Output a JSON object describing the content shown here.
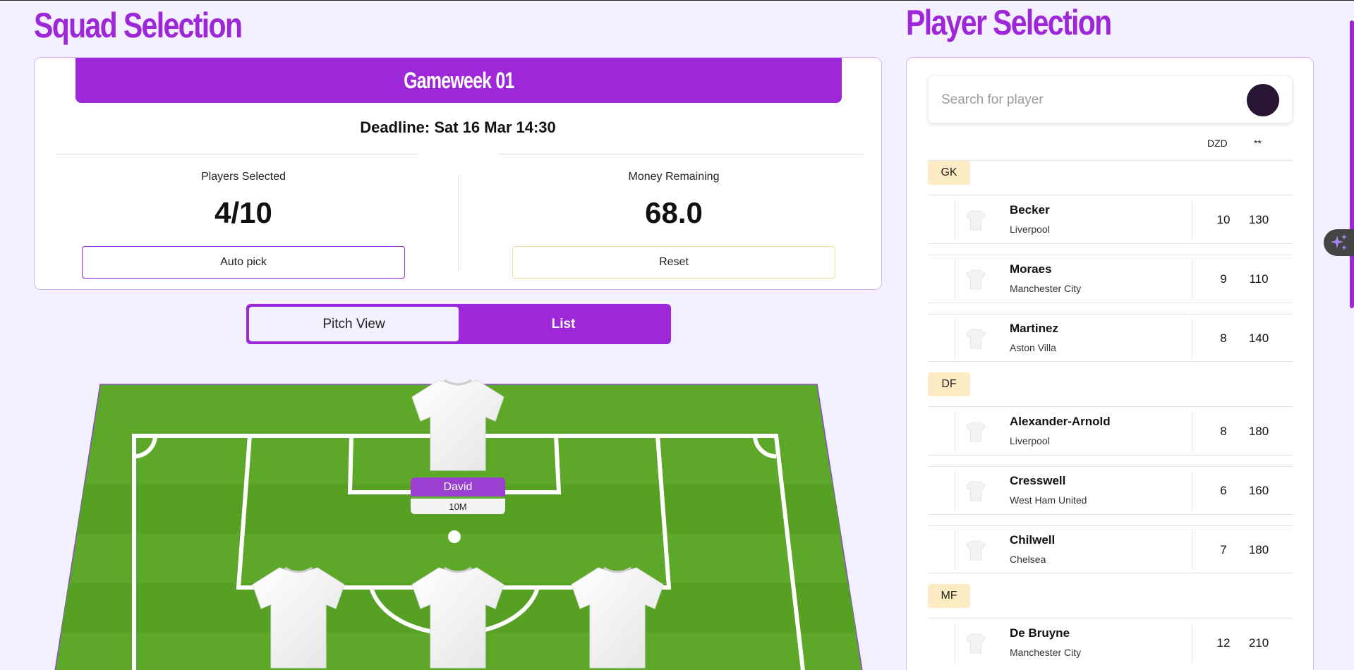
{
  "squad": {
    "title": "Squad Selection",
    "gameweek": "Gameweek 01",
    "deadline": "Deadline: Sat 16 Mar 14:30",
    "players_selected_label": "Players Selected",
    "players_selected_value": "4/10",
    "money_label": "Money Remaining",
    "money_value": "68.0",
    "auto_pick_label": "Auto pick",
    "reset_label": "Reset"
  },
  "view_toggle": {
    "options": [
      "Pitch View",
      "List"
    ],
    "active": "Pitch View"
  },
  "pitch": {
    "goalkeeper": {
      "name": "David",
      "price": "10M"
    },
    "colors": {
      "grass": "#5da829",
      "tag": "#9b3fd0"
    }
  },
  "player_selection": {
    "title": "Player Selection",
    "search_placeholder": "Search for player",
    "col_dzd": "DZD",
    "col_pts": "**",
    "groups": [
      {
        "position": "GK",
        "players": [
          {
            "name": "Becker",
            "club": "Liverpool",
            "dzd": "10",
            "pts": "130"
          },
          {
            "name": "Moraes",
            "club": "Manchester City",
            "dzd": "9",
            "pts": "110"
          },
          {
            "name": "Martinez",
            "club": "Aston Villa",
            "dzd": "8",
            "pts": "140"
          }
        ]
      },
      {
        "position": "DF",
        "players": [
          {
            "name": "Alexander-Arnold",
            "club": "Liverpool",
            "dzd": "8",
            "pts": "180"
          },
          {
            "name": "Cresswell",
            "club": "West Ham United",
            "dzd": "6",
            "pts": "160"
          },
          {
            "name": "Chilwell",
            "club": "Chelsea",
            "dzd": "7",
            "pts": "180"
          }
        ]
      },
      {
        "position": "MF",
        "players": [
          {
            "name": "De Bruyne",
            "club": "Manchester City",
            "dzd": "12",
            "pts": "210"
          }
        ]
      }
    ]
  },
  "theme": {
    "accent": "#9d27d9",
    "background": "#f3f1ff",
    "position_badge": "#fdebc4"
  }
}
